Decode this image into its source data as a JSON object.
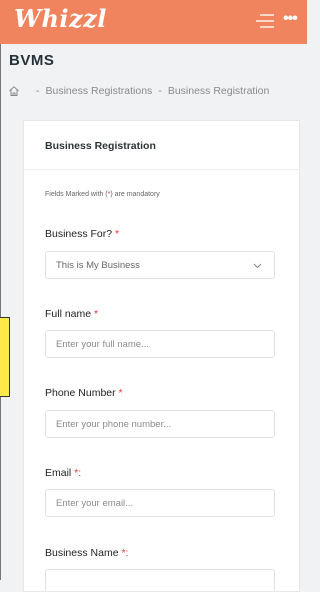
{
  "app": {
    "logo": "Whizzl"
  },
  "page": {
    "title": "BVMS"
  },
  "breadcrumb": {
    "separator": "-",
    "items": [
      "Business Registrations",
      "Business Registration"
    ]
  },
  "card": {
    "title": "Business Registration",
    "note_prefix": "Fields Marked with (",
    "note_star": "*",
    "note_suffix": ") are mandatory"
  },
  "form": {
    "business_for": {
      "label": "Business For?",
      "req": "*",
      "value": "This is My Business"
    },
    "full_name": {
      "label": "Full name",
      "req": "*",
      "placeholder": "Enter your full name..."
    },
    "phone": {
      "label": "Phone Number",
      "req": "*",
      "placeholder": "Enter your phone number..."
    },
    "email": {
      "label": "Email",
      "req": "*:",
      "placeholder": "Enter your email..."
    },
    "business_name": {
      "label": "Business Name",
      "req": "*:"
    }
  },
  "colors": {
    "brand": "#f0845e",
    "required": "#e53935",
    "marker": "#ffe94a"
  },
  "icons": {
    "menu": "hamburger-icon",
    "more": "more-dots-icon",
    "home": "home-icon",
    "select": "chevron-down-icon"
  }
}
